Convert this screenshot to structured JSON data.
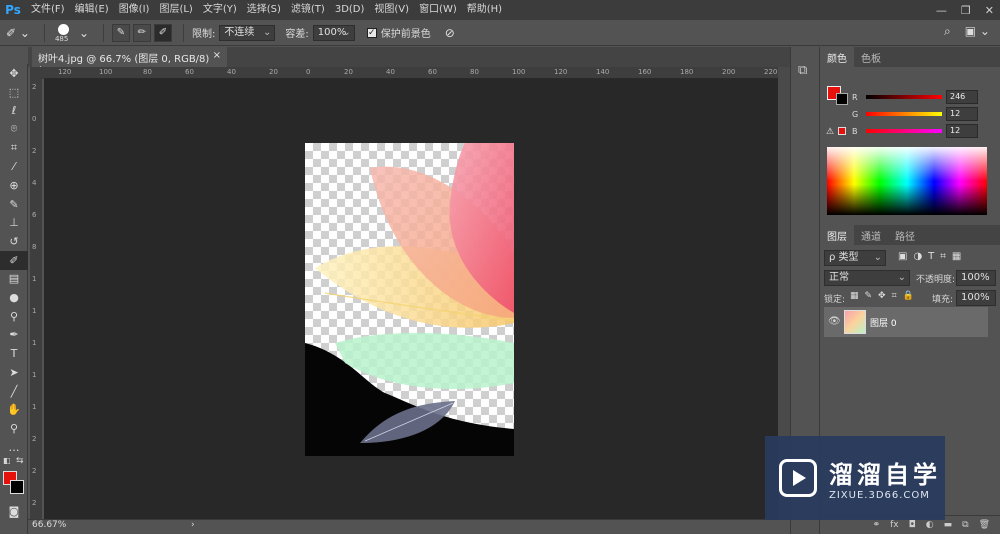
{
  "app": {
    "logo": "Ps"
  },
  "menu": [
    "文件(F)",
    "编辑(E)",
    "图像(I)",
    "图层(L)",
    "文字(Y)",
    "选择(S)",
    "滤镜(T)",
    "3D(D)",
    "视图(V)",
    "窗口(W)",
    "帮助(H)"
  ],
  "window_controls": [
    "—",
    "❐",
    "✕"
  ],
  "options": {
    "brush_size": "485",
    "limit_label": "限制:",
    "limit_value": "不连续",
    "tolerance_label": "容差:",
    "tolerance_value": "100%",
    "protect_label": "保护前景色",
    "protect_checked": true
  },
  "document": {
    "tab_title": "树叶4.jpg @ 66.7% (图层 0, RGB/8) *",
    "close": "×",
    "zoom": "66.67%"
  },
  "rulers": {
    "h": [
      "120",
      "100",
      "80",
      "60",
      "40",
      "20",
      "0",
      "20",
      "40",
      "60",
      "80",
      "100",
      "120",
      "140",
      "160",
      "180",
      "200",
      "220"
    ],
    "v": [
      "2",
      "0",
      "2",
      "4",
      "6",
      "8",
      "1",
      "1",
      "1",
      "1",
      "1",
      "2",
      "2",
      "2"
    ]
  },
  "color_panel": {
    "tabs": [
      "颜色",
      "色板"
    ],
    "foreground": "#e6110c",
    "background": "#000000",
    "r": {
      "label": "R",
      "value": "246"
    },
    "g": {
      "label": "G",
      "value": "12"
    },
    "b": {
      "label": "B",
      "value": "12"
    }
  },
  "layers_panel": {
    "tabs": [
      "图层",
      "通道",
      "路径"
    ],
    "filter_label": "ρ 类型",
    "blend_mode": "正常",
    "opacity_label": "不透明度:",
    "opacity_value": "100%",
    "lock_label": "锁定:",
    "fill_label": "填充:",
    "fill_value": "100%",
    "layers": [
      {
        "name": "图层 0",
        "visible": true
      }
    ]
  },
  "watermark": {
    "title": "溜溜自学",
    "subtitle": "ZIXUE.3D66.COM"
  }
}
